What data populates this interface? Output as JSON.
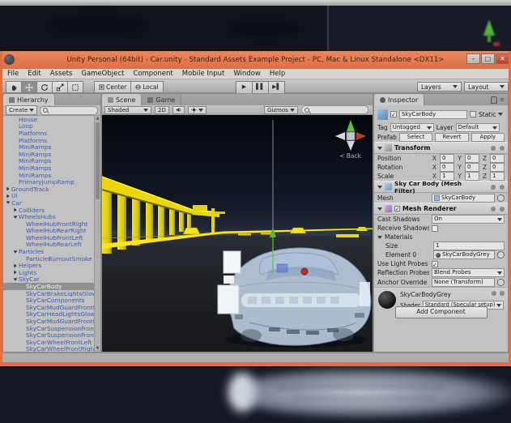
{
  "window": {
    "title": "Unity Personal (64bit) - Car.unity - Standard Assets Example Project - PC, Mac & Linux Standalone <DX11>",
    "controls": {
      "minimize": "–",
      "maximize": "□",
      "close": "✕"
    }
  },
  "menu": {
    "items": [
      "File",
      "Edit",
      "Assets",
      "GameObject",
      "Component",
      "Mobile Input",
      "Window",
      "Help"
    ]
  },
  "toolbar": {
    "tools": [
      "hand-tool",
      "move-tool",
      "rotate-tool",
      "scale-tool",
      "rect-tool"
    ],
    "active_tool": "move-tool",
    "pivot_label": "Center",
    "space_label": "Local",
    "play": "▶",
    "pause": "▌▌",
    "step": "▶▌",
    "layers_label": "Layers",
    "layout_label": "Layout"
  },
  "hierarchy": {
    "tab": "Hierarchy",
    "create_label": "Create",
    "items": [
      {
        "label": "House",
        "indent": 1
      },
      {
        "label": "Loop",
        "indent": 1
      },
      {
        "label": "Platforms",
        "indent": 1
      },
      {
        "label": "Platforms",
        "indent": 1
      },
      {
        "label": "MiniRamps",
        "indent": 1
      },
      {
        "label": "MiniRamps",
        "indent": 1
      },
      {
        "label": "MiniRamps",
        "indent": 1
      },
      {
        "label": "MiniRamps",
        "indent": 1
      },
      {
        "label": "MiniRamps",
        "indent": 1
      },
      {
        "label": "PrimaryJumpRamp",
        "indent": 1
      },
      {
        "label": "GroundTrack",
        "indent": 0,
        "arrow": "right"
      },
      {
        "label": "UI",
        "indent": 0,
        "arrow": "right"
      },
      {
        "label": "Car",
        "indent": 0,
        "arrow": "down"
      },
      {
        "label": "Colliders",
        "indent": 1,
        "arrow": "right"
      },
      {
        "label": "WheelsHubs",
        "indent": 1,
        "arrow": "down"
      },
      {
        "label": "WheelHubFrontRight",
        "indent": 2
      },
      {
        "label": "WheelHubRearRight",
        "indent": 2
      },
      {
        "label": "WheelHubFrontLeft",
        "indent": 2
      },
      {
        "label": "WheelHubRearLeft",
        "indent": 2
      },
      {
        "label": "Particles",
        "indent": 1,
        "arrow": "down"
      },
      {
        "label": "ParticleBurnoutSmoke",
        "indent": 2
      },
      {
        "label": "Helpers",
        "indent": 1,
        "arrow": "right"
      },
      {
        "label": "Lights",
        "indent": 1,
        "arrow": "right"
      },
      {
        "label": "SkyCar",
        "indent": 1,
        "arrow": "down"
      },
      {
        "label": "SkyCarBody",
        "indent": 2,
        "selected": true
      },
      {
        "label": "SkyCarBrakeLightsGlow",
        "indent": 2
      },
      {
        "label": "SkyCarComponents",
        "indent": 2
      },
      {
        "label": "SkyCarMudGuardFrontRight",
        "indent": 2
      },
      {
        "label": "SkyCarHeadLightsGlow",
        "indent": 2
      },
      {
        "label": "SkyCarMudGuardFrontLeft",
        "indent": 2
      },
      {
        "label": "SkyCarSuspensionFrontLeft",
        "indent": 2
      },
      {
        "label": "SkyCarSuspensionFrontRight",
        "indent": 2
      },
      {
        "label": "SkyCarWheelFrontLeft",
        "indent": 2
      },
      {
        "label": "SkyCarWheelFrontRight",
        "indent": 2
      }
    ]
  },
  "scene": {
    "tab_scene": "Scene",
    "tab_game": "Game",
    "shaded_label": "Shaded",
    "mode_2d_label": "2D",
    "gizmos_label": "Gizmos",
    "back_label": "< Back"
  },
  "inspector": {
    "tab": "Inspector",
    "header": {
      "name": "SkyCarBody",
      "static_label": "Static",
      "tag_label": "Tag",
      "tag_value": "Untagged",
      "layer_label": "Layer",
      "layer_value": "Default",
      "prefab_label": "Prefab",
      "prefab_buttons": [
        "Select",
        "Revert",
        "Apply"
      ]
    },
    "transform": {
      "title": "Transform",
      "axis": [
        "X",
        "Y",
        "Z"
      ],
      "rows": [
        {
          "label": "Position",
          "x": "0",
          "y": "0",
          "z": "0"
        },
        {
          "label": "Rotation",
          "x": "0",
          "y": "0",
          "z": "0"
        },
        {
          "label": "Scale",
          "x": "1",
          "y": "1",
          "z": "1"
        }
      ]
    },
    "mesh_filter": {
      "title": "Sky Car Body (Mesh Filter)",
      "mesh_label": "Mesh",
      "mesh_value": "SkyCarBody"
    },
    "mesh_renderer": {
      "title": "Mesh Renderer",
      "cast_shadows_label": "Cast Shadows",
      "cast_shadows_value": "On",
      "receive_shadows_label": "Receive Shadows",
      "materials_label": "Materials",
      "size_label": "Size",
      "size_value": "1",
      "element0_label": "Element 0",
      "element0_value": "SkyCarBodyGrey",
      "light_probes_label": "Use Light Probes",
      "reflection_label": "Reflection Probes",
      "reflection_value": "Blend Probes",
      "anchor_label": "Anchor Override",
      "anchor_value": "None (Transform)"
    },
    "material": {
      "name": "SkyCarBodyGrey",
      "shader_label": "Shader",
      "shader_value": "Standard (Specular setup)"
    },
    "add_component_label": "Add Component"
  },
  "icons": {
    "check": "✓",
    "scroll_up": "▲",
    "scroll_down": "▼"
  },
  "colors": {
    "frame_orange": "#dd7044",
    "prefab_text_blue": "#3e5ba9",
    "selection_gray": "#8f8f8f",
    "scene_yellow": "#ead80c",
    "car_body_blue": "rgba(206,224,243,0.82)",
    "gizmo_green": "#5fbf3f",
    "gizmo_red": "#b5402c"
  }
}
